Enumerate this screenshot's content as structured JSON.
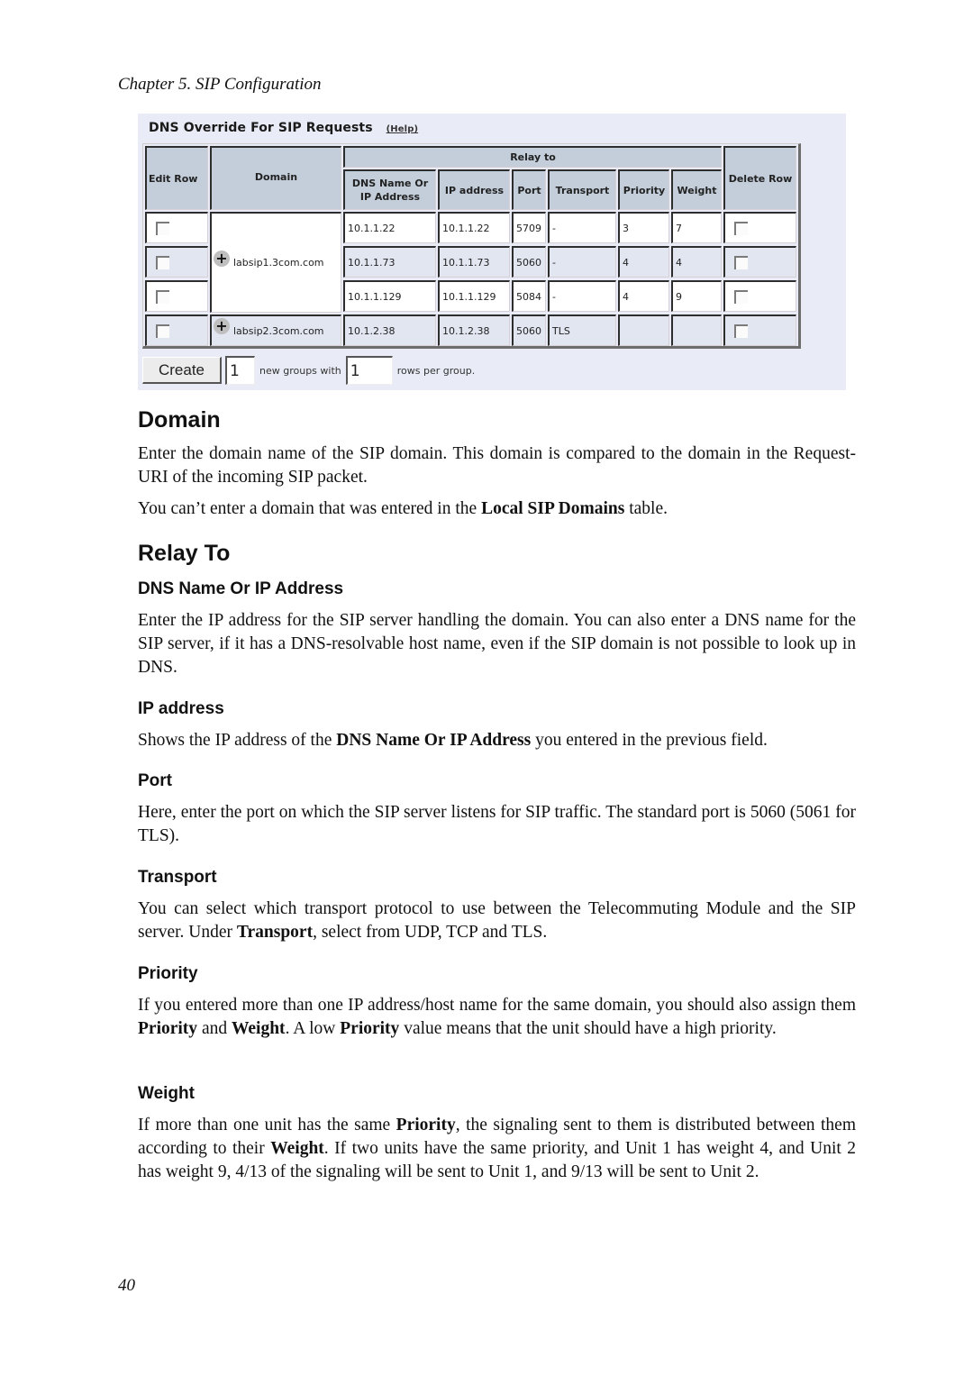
{
  "running_head": "Chapter 5. SIP Configuration",
  "screenshot": {
    "title": "DNS Override For SIP Requests",
    "help_link": "(Help)",
    "headers": {
      "edit_row": "Edit Row",
      "domain": "Domain",
      "relay_to": "Relay to",
      "dns_name": "DNS Name Or IP Address",
      "ip_address": "IP address",
      "port": "Port",
      "transport": "Transport",
      "priority": "Priority",
      "weight": "Weight",
      "delete_row": "Delete Row"
    },
    "groups": [
      {
        "domain": "labsip1.3com.com"
      },
      {
        "domain": "labsip2.3com.com"
      }
    ],
    "rows": [
      {
        "dns_name": "10.1.1.22",
        "ip_address": "10.1.1.22",
        "port": "5709",
        "transport": "-",
        "priority": "3",
        "weight": "7",
        "edit_checked": false,
        "delete_checked": false
      },
      {
        "dns_name": "10.1.1.73",
        "ip_address": "10.1.1.73",
        "port": "5060",
        "transport": "-",
        "priority": "4",
        "weight": "4",
        "edit_checked": false,
        "delete_checked": false
      },
      {
        "dns_name": "10.1.1.129",
        "ip_address": "10.1.1.129",
        "port": "5084",
        "transport": "-",
        "priority": "4",
        "weight": "9",
        "edit_checked": false,
        "delete_checked": false
      },
      {
        "dns_name": "10.1.2.38",
        "ip_address": "10.1.2.38",
        "port": "5060",
        "transport": "TLS",
        "priority": "",
        "weight": "",
        "edit_checked": false,
        "delete_checked": false
      }
    ],
    "create": {
      "button_label": "Create",
      "groups_value": "1",
      "groups_suffix": "new groups with",
      "rows_value": "1",
      "rows_suffix": "rows per group."
    }
  },
  "sections": {
    "domain": {
      "heading": "Domain",
      "p1": "Enter the domain name of the SIP domain. This domain is compared to the domain in the Request-URI of the incoming SIP packet.",
      "p2_pre": "You can’t enter a domain that was entered in the ",
      "p2_bold": "Local SIP Domains",
      "p2_post": " table."
    },
    "relay_to": {
      "heading": "Relay To"
    },
    "dns_name": {
      "heading": "DNS Name Or IP Address",
      "p1": "Enter the IP address for the SIP server handling the domain. You can also enter a DNS name for the SIP server, if it has a DNS-resolvable host name, even if the SIP domain is not possible to look up in DNS."
    },
    "ip_address": {
      "heading": "IP address",
      "p_pre": "Shows the IP address of the ",
      "p_bold": "DNS Name Or IP Address",
      "p_post": " you entered in the previous field."
    },
    "port": {
      "heading": "Port",
      "p1": "Here, enter the port on which the SIP server listens for SIP traffic. The standard port is 5060 (5061 for TLS)."
    },
    "transport": {
      "heading": "Transport",
      "p_pre": "You can select which transport protocol to use between the Telecommuting Module and the SIP server. Under ",
      "p_bold": "Transport",
      "p_post": ", select from UDP, TCP and TLS."
    },
    "priority": {
      "heading": "Priority",
      "p_1": "If you entered more than one IP address/host name for the same domain, you should also assign them ",
      "p_b1": "Priority",
      "p_2": " and ",
      "p_b2": "Weight",
      "p_3": ". A low ",
      "p_b3": "Priority",
      "p_4": " value means that the unit should have a high priority."
    },
    "weight": {
      "heading": "Weight",
      "p_1": "If more than one unit has the same ",
      "p_b1": "Priority",
      "p_2": ", the signaling sent to them is distributed between them according to their ",
      "p_b2": "Weight",
      "p_3": ". If two units have the same priority, and Unit 1 has weight 4, and Unit 2 has weight 9, 4/13 of the signaling will be sent to Unit 1, and 9/13 will be sent to Unit 2."
    }
  },
  "page_number": "40"
}
